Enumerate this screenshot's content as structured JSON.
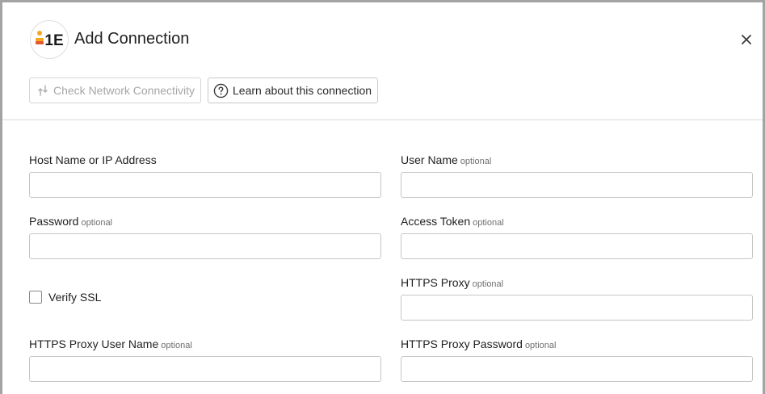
{
  "dialog": {
    "title": "Add Connection",
    "logo_text": "1E",
    "close_icon": "close-icon"
  },
  "toolbar": {
    "check_label": "Check Network Connectivity",
    "check_icon": "network-check-icon",
    "learn_label": "Learn about this connection",
    "learn_icon": "question-circle-icon"
  },
  "form": {
    "optional_text": "optional",
    "host": {
      "label": "Host Name or IP Address",
      "value": ""
    },
    "user_name": {
      "label": "User Name",
      "value": ""
    },
    "password": {
      "label": "Password",
      "value": ""
    },
    "access_token": {
      "label": "Access Token",
      "value": ""
    },
    "verify_ssl": {
      "label": "Verify SSL",
      "checked": false
    },
    "https_proxy": {
      "label": "HTTPS Proxy",
      "value": ""
    },
    "https_proxy_user": {
      "label": "HTTPS Proxy User Name",
      "value": ""
    },
    "https_proxy_password": {
      "label": "HTTPS Proxy Password",
      "value": ""
    }
  },
  "colors": {
    "logo_orange": "#f5a623",
    "logo_red": "#e4572e",
    "logo_dark": "#1a1a1a",
    "border": "#c6c6c6",
    "disabled_text": "#a6a6a6"
  }
}
